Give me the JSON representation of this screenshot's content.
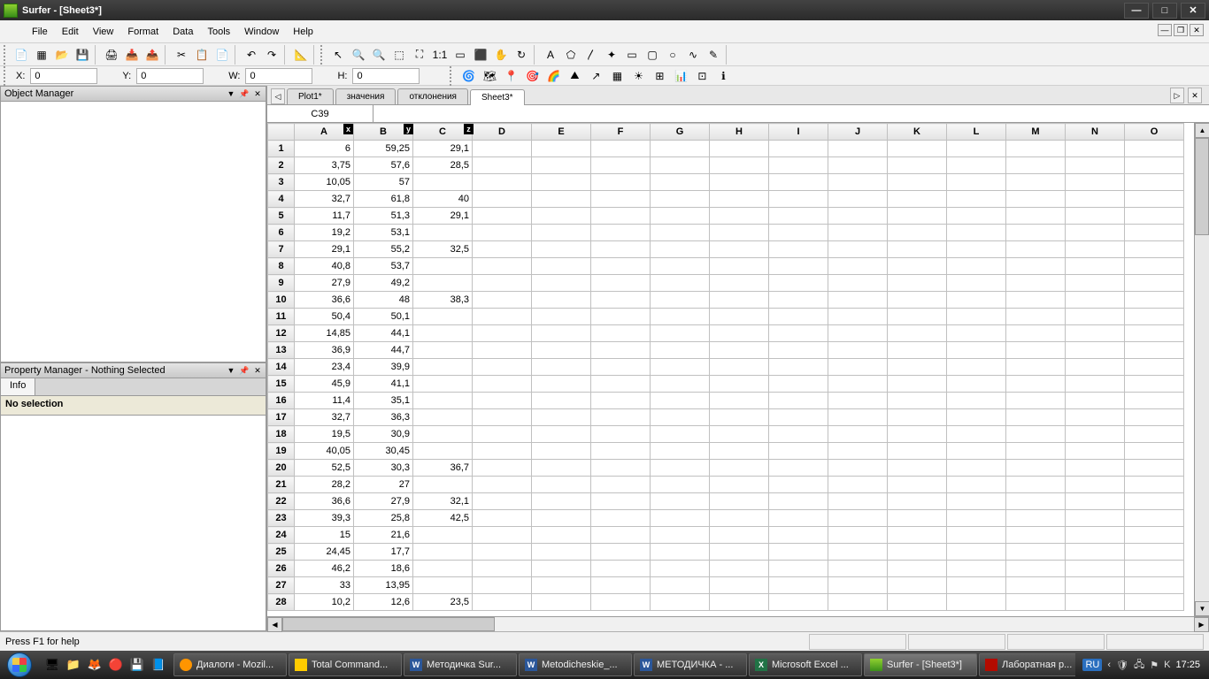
{
  "app": {
    "title": "Surfer - [Sheet3*]"
  },
  "menu": [
    "File",
    "Edit",
    "View",
    "Format",
    "Data",
    "Tools",
    "Window",
    "Help"
  ],
  "coords": {
    "x_lbl": "X:",
    "x": "0",
    "y_lbl": "Y:",
    "y": "0",
    "w_lbl": "W:",
    "w": "0",
    "h_lbl": "H:",
    "h": "0"
  },
  "panels": {
    "object_manager": "Object Manager",
    "property_manager": "Property Manager - Nothing Selected",
    "info_tab": "Info",
    "no_selection": "No selection"
  },
  "doc_tabs": [
    "Plot1*",
    "значения",
    "отклонения",
    "Sheet3*"
  ],
  "active_doc_tab": 3,
  "namebox": "C39",
  "columns": [
    "A",
    "B",
    "C",
    "D",
    "E",
    "F",
    "G",
    "H",
    "I",
    "J",
    "K",
    "L",
    "M",
    "N",
    "O"
  ],
  "col_badges": {
    "A": "x",
    "B": "y",
    "C": "z"
  },
  "rows": [
    {
      "n": 1,
      "A": "6",
      "B": "59,25",
      "C": "29,1"
    },
    {
      "n": 2,
      "A": "3,75",
      "B": "57,6",
      "C": "28,5"
    },
    {
      "n": 3,
      "A": "10,05",
      "B": "57",
      "C": ""
    },
    {
      "n": 4,
      "A": "32,7",
      "B": "61,8",
      "C": "40"
    },
    {
      "n": 5,
      "A": "11,7",
      "B": "51,3",
      "C": "29,1"
    },
    {
      "n": 6,
      "A": "19,2",
      "B": "53,1",
      "C": ""
    },
    {
      "n": 7,
      "A": "29,1",
      "B": "55,2",
      "C": "32,5"
    },
    {
      "n": 8,
      "A": "40,8",
      "B": "53,7",
      "C": ""
    },
    {
      "n": 9,
      "A": "27,9",
      "B": "49,2",
      "C": ""
    },
    {
      "n": 10,
      "A": "36,6",
      "B": "48",
      "C": "38,3"
    },
    {
      "n": 11,
      "A": "50,4",
      "B": "50,1",
      "C": ""
    },
    {
      "n": 12,
      "A": "14,85",
      "B": "44,1",
      "C": ""
    },
    {
      "n": 13,
      "A": "36,9",
      "B": "44,7",
      "C": ""
    },
    {
      "n": 14,
      "A": "23,4",
      "B": "39,9",
      "C": ""
    },
    {
      "n": 15,
      "A": "45,9",
      "B": "41,1",
      "C": ""
    },
    {
      "n": 16,
      "A": "11,4",
      "B": "35,1",
      "C": ""
    },
    {
      "n": 17,
      "A": "32,7",
      "B": "36,3",
      "C": ""
    },
    {
      "n": 18,
      "A": "19,5",
      "B": "30,9",
      "C": ""
    },
    {
      "n": 19,
      "A": "40,05",
      "B": "30,45",
      "C": ""
    },
    {
      "n": 20,
      "A": "52,5",
      "B": "30,3",
      "C": "36,7"
    },
    {
      "n": 21,
      "A": "28,2",
      "B": "27",
      "C": ""
    },
    {
      "n": 22,
      "A": "36,6",
      "B": "27,9",
      "C": "32,1"
    },
    {
      "n": 23,
      "A": "39,3",
      "B": "25,8",
      "C": "42,5"
    },
    {
      "n": 24,
      "A": "15",
      "B": "21,6",
      "C": ""
    },
    {
      "n": 25,
      "A": "24,45",
      "B": "17,7",
      "C": ""
    },
    {
      "n": 26,
      "A": "46,2",
      "B": "18,6",
      "C": ""
    },
    {
      "n": 27,
      "A": "33",
      "B": "13,95",
      "C": ""
    },
    {
      "n": 28,
      "A": "10,2",
      "B": "12,6",
      "C": "23,5"
    }
  ],
  "status": "Press F1 for help",
  "taskbar": {
    "items": [
      {
        "icon": "f",
        "label": "Диалоги - Mozil..."
      },
      {
        "icon": "t",
        "label": "Total Command..."
      },
      {
        "icon": "w",
        "label": "Методичка Sur..."
      },
      {
        "icon": "w",
        "label": "Metodicheskie_..."
      },
      {
        "icon": "w",
        "label": "МЕТОДИЧКА - ..."
      },
      {
        "icon": "x",
        "label": "Microsoft Excel ..."
      },
      {
        "icon": "s",
        "label": "Surfer - [Sheet3*]"
      },
      {
        "icon": "p",
        "label": "Лаборатная р..."
      }
    ],
    "active": 6,
    "lang": "RU",
    "time": "17:25"
  }
}
